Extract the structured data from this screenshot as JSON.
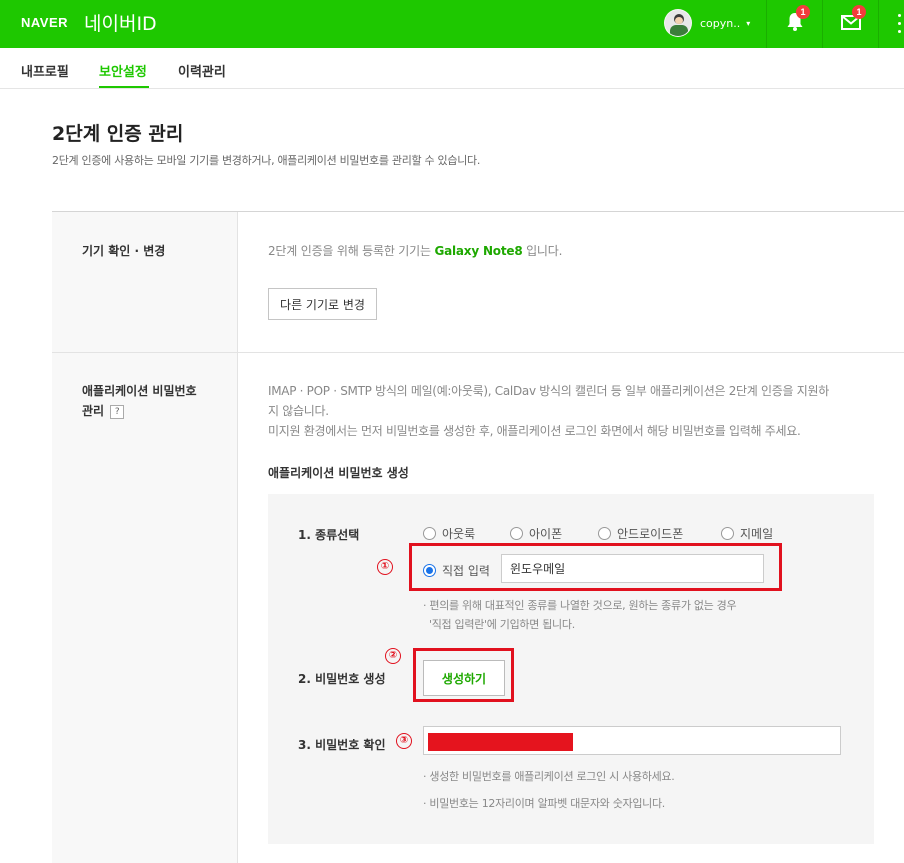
{
  "header": {
    "brand": "NAVER",
    "title": "네이버ID",
    "username": "copyn..",
    "caret": "▾",
    "notification_count": "1",
    "mail_count": "1"
  },
  "tabs": [
    {
      "label": "내프로필",
      "active": false
    },
    {
      "label": "보안설정",
      "active": true
    },
    {
      "label": "이력관리",
      "active": false
    }
  ],
  "page": {
    "title": "2단계 인증 관리",
    "description": "2단계 인증에 사용하는 모바일 기기를 변경하거나, 애플리케이션 비밀번호를 관리할 수 있습니다."
  },
  "device": {
    "label": "기기 확인 · 변경",
    "text_before": "2단계 인증을 위해 등록한 기기는",
    "device_name": "Galaxy Note8",
    "text_after": "입니다.",
    "change_button": "다른 기기로 변경"
  },
  "app_password": {
    "label_line1": "애플리케이션 비밀번호",
    "label_line2": "관리",
    "help": "?",
    "desc_line1": "IMAP · POP · SMTP 방식의 메일(예:아웃룩), CalDav 방식의 캘린더 등 일부 애플리케이션은 2단계 인증을 지원하",
    "desc_line2": "지 않습니다.",
    "desc_line3": "미지원 환경에서는 먼저 비밀번호를 생성한 후, 애플리케이션 로그인 화면에서 해당 비밀번호를 입력해 주세요.",
    "section_title": "애플리케이션 비밀번호 생성",
    "step1_label": "1. 종류선택",
    "types": [
      "아웃룩",
      "아이폰",
      "안드로이드폰",
      "지메일"
    ],
    "direct_input_label": "직접 입력",
    "direct_input_value": "윈도우메일",
    "hint1_line1": "· 편의를 위해 대표적인 종류를 나열한 것으로, 원하는 종류가 없는 경우",
    "hint1_line2": "'직접 입력란'에 기입하면 됩니다.",
    "step2_label": "2. 비밀번호 생성",
    "generate_button": "생성하기",
    "step3_label": "3. 비밀번호 확인",
    "hint2": "· 생성한 비밀번호를 애플리케이션 로그인 시 사용하세요.",
    "hint3": "· 비밀번호는 12자리이며 알파벳 대문자와 숫자입니다."
  },
  "annotations": [
    "①",
    "②",
    "③"
  ],
  "colors": {
    "brand_green": "#1ec800",
    "annotation_red": "#e1111e",
    "link_green": "#1ea800"
  }
}
